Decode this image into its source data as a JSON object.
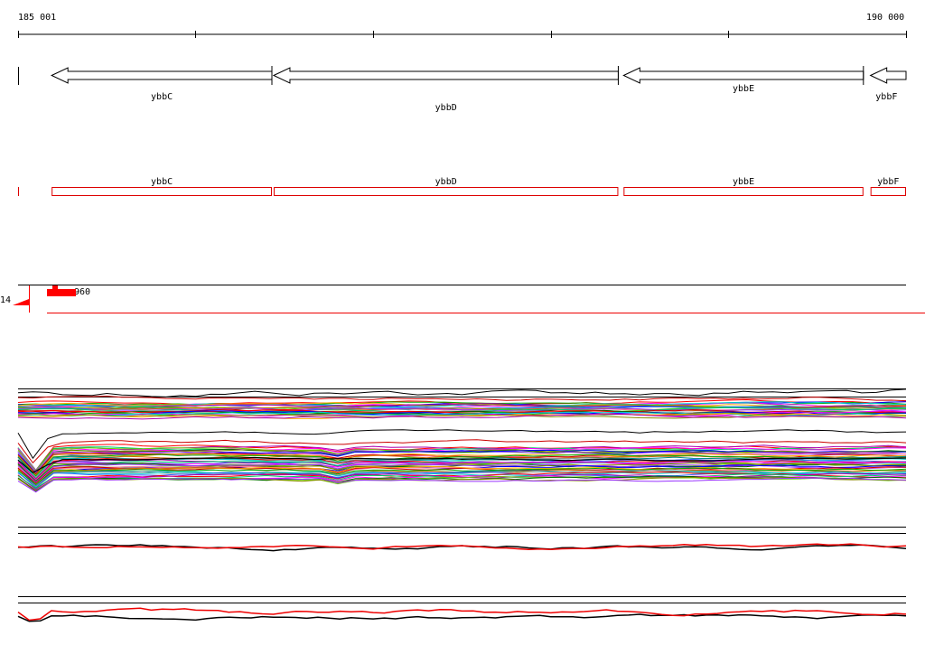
{
  "ruler": {
    "start_label": "185 001",
    "end_label": "190 000",
    "start": 185001,
    "end": 190000,
    "ticks": [
      185001,
      186000,
      187000,
      188000,
      189000,
      190000
    ]
  },
  "genes": [
    {
      "name": "ybbC",
      "start": 185190,
      "end": 186430,
      "strand": "-",
      "label_row": 0
    },
    {
      "name": "ybbD",
      "start": 186440,
      "end": 188380,
      "strand": "-",
      "label_row": 1
    },
    {
      "name": "ybbE",
      "start": 188410,
      "end": 189760,
      "strand": "-",
      "label_row": 0
    },
    {
      "name": "ybbF",
      "start": 189800,
      "end": 190000,
      "strand": "-",
      "label_row": 0
    }
  ],
  "coverage_track": {
    "min_label": "14",
    "max_label": "960"
  },
  "colors": {
    "gene_outline": "#000000",
    "feature_box": "#dd0000",
    "coverage_fill": "#ff0000",
    "track_rule": "#000000",
    "red_line": "#ee0000"
  }
}
